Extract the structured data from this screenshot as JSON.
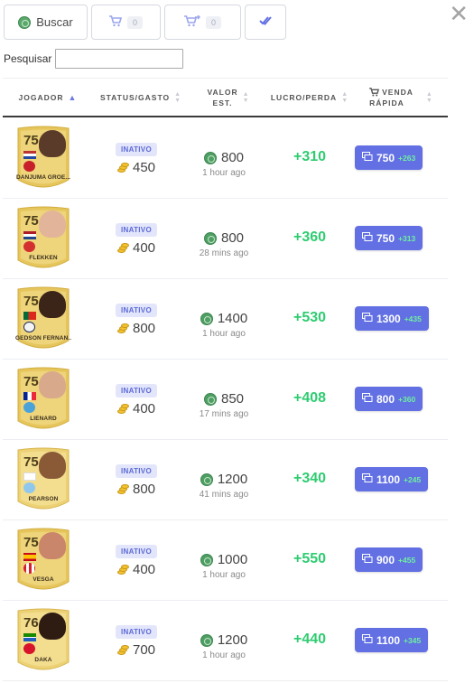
{
  "toolbar": {
    "buscar_label": "Buscar",
    "cart_count": "0",
    "transfer_count": "0"
  },
  "search": {
    "label": "Pesquisar",
    "value": "",
    "placeholder": ""
  },
  "table": {
    "headers": {
      "player": "JOGADOR",
      "status_line1": "STATUS/GASTO",
      "value_line1": "VALOR",
      "value_line2": "EST.",
      "profit": "LUCRO/PERDA",
      "sell_line1": "VENDA",
      "sell_line2": "RÁPIDA"
    },
    "rows": [
      {
        "rating": "75",
        "name": "DANJUMA GROE...",
        "status": "INATIVO",
        "spent": "450",
        "value": "800",
        "time": "1 hour ago",
        "profit": "+310",
        "price": "750",
        "delta": "+263"
      },
      {
        "rating": "75",
        "name": "FLEKKEN",
        "status": "INATIVO",
        "spent": "400",
        "value": "800",
        "time": "28 mins ago",
        "profit": "+360",
        "price": "750",
        "delta": "+313"
      },
      {
        "rating": "75",
        "name": "GEDSON FERNAN...",
        "status": "INATIVO",
        "spent": "800",
        "value": "1400",
        "time": "1 hour ago",
        "profit": "+530",
        "price": "1300",
        "delta": "+435"
      },
      {
        "rating": "75",
        "name": "LIÉNARD",
        "status": "INATIVO",
        "spent": "400",
        "value": "850",
        "time": "17 mins ago",
        "profit": "+408",
        "price": "800",
        "delta": "+360"
      },
      {
        "rating": "75",
        "name": "PEARSON",
        "status": "INATIVO",
        "spent": "800",
        "value": "1200",
        "time": "41 mins ago",
        "profit": "+340",
        "price": "1100",
        "delta": "+245"
      },
      {
        "rating": "75",
        "name": "VESGA",
        "status": "INATIVO",
        "spent": "400",
        "value": "1000",
        "time": "1 hour ago",
        "profit": "+550",
        "price": "900",
        "delta": "+455"
      },
      {
        "rating": "76",
        "name": "DAKA",
        "status": "INATIVO",
        "spent": "700",
        "value": "1200",
        "time": "1 hour ago",
        "profit": "+440",
        "price": "1100",
        "delta": "+345"
      }
    ]
  },
  "colors": {
    "accent": "#6270e3",
    "profit_green": "#2ecc71",
    "badge_bg": "#e3e6fb",
    "card_gold": "#e6c65c"
  }
}
